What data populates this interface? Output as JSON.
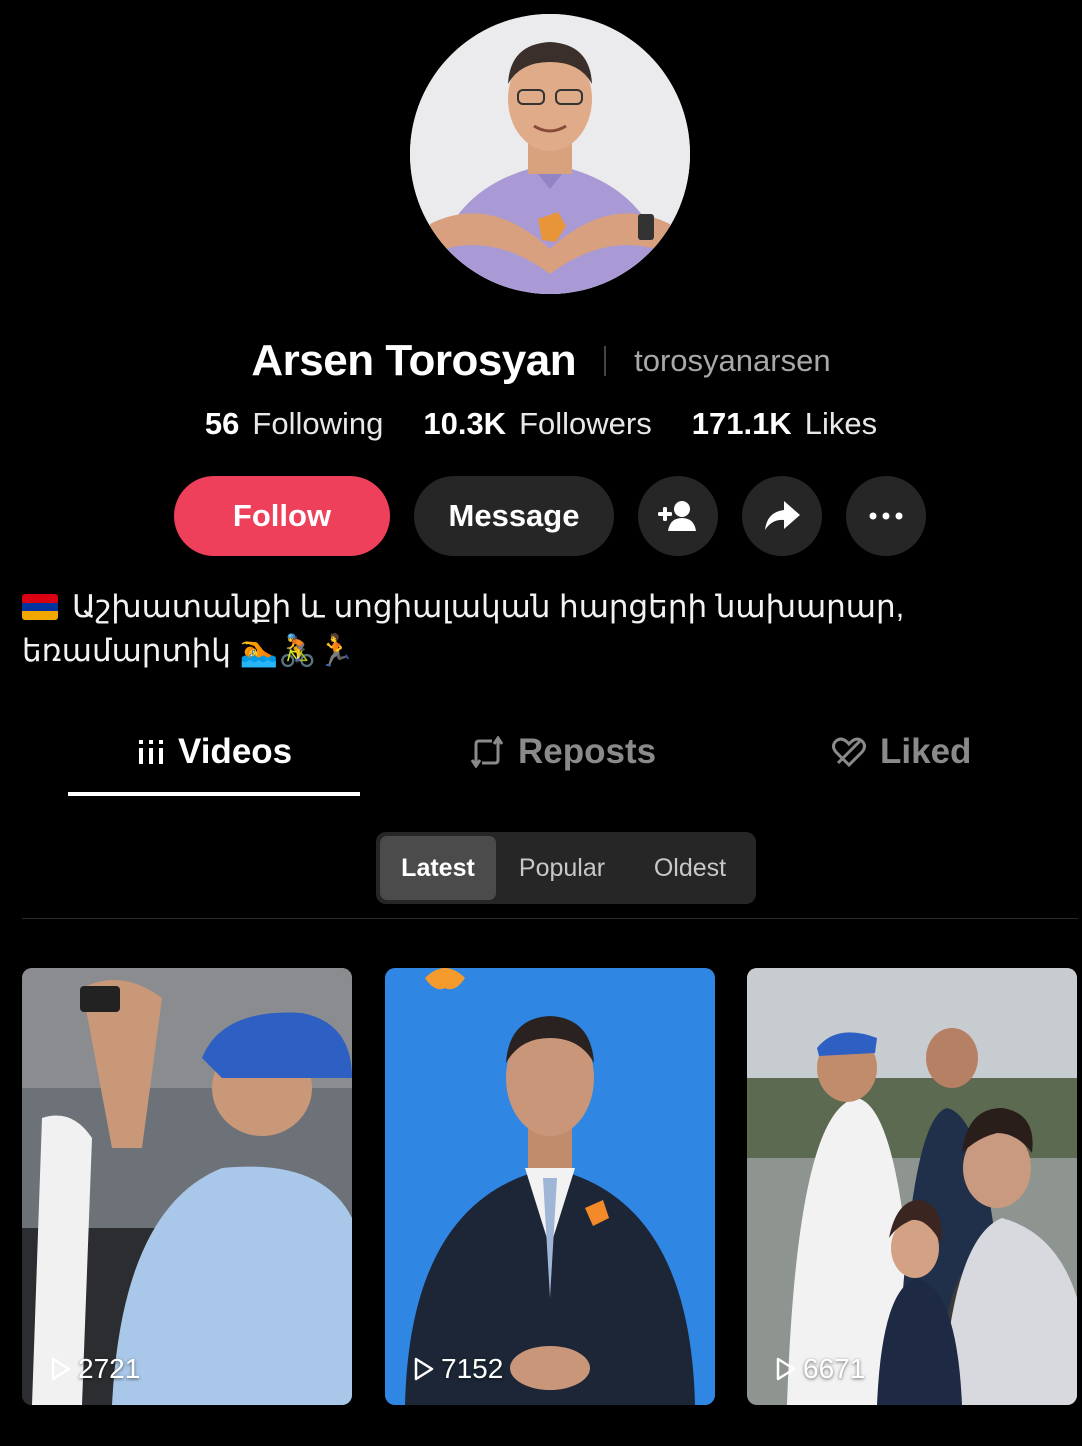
{
  "profile": {
    "display_name": "Arsen Torosyan",
    "handle": "torosyanarsen"
  },
  "stats": [
    {
      "value": "56",
      "label": "Following"
    },
    {
      "value": "10.3K",
      "label": "Followers"
    },
    {
      "value": "171.1K",
      "label": "Likes"
    }
  ],
  "actions": {
    "follow_label": "Follow",
    "message_label": "Message",
    "add_friend_icon": "add-person-icon",
    "share_icon": "share-arrow-icon",
    "more_icon": "more-dots-icon"
  },
  "bio": {
    "flag_icon": "armenia-flag-icon",
    "text_line1": "Աշխատանքի և սոցիալական հարցերի նախարար,",
    "text_line2": "եռամարտիկ 🏊🚴🏃"
  },
  "tabs": [
    {
      "label": "Videos",
      "icon": "grid-icon",
      "active": true
    },
    {
      "label": "Reposts",
      "icon": "repost-icon",
      "active": false
    },
    {
      "label": "Liked",
      "icon": "heart-icon",
      "active": false
    }
  ],
  "sort": {
    "options": [
      "Latest",
      "Popular",
      "Oldest"
    ],
    "selected": "Latest"
  },
  "videos": [
    {
      "views": "2721"
    },
    {
      "views": "7152"
    },
    {
      "views": "6671"
    }
  ],
  "colors": {
    "background": "#000000",
    "follow_button": "#ee3f5b",
    "secondary_button": "#262626",
    "muted_text": "#8a8a8a",
    "selected_segment": "#4b4b4b"
  }
}
